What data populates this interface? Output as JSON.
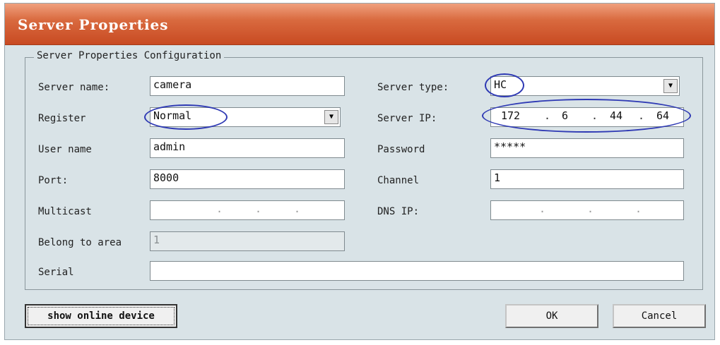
{
  "dialog": {
    "title": "Server Properties"
  },
  "group": {
    "legend": "Server Properties Configuration"
  },
  "fields": {
    "server_name": {
      "label": "Server name:",
      "value": "camera"
    },
    "register": {
      "label": "Register",
      "value": "Normal"
    },
    "user_name": {
      "label": "User name",
      "value": "admin"
    },
    "port": {
      "label": "Port:",
      "value": "8000"
    },
    "multicast": {
      "label": "Multicast",
      "value": ""
    },
    "belong_to_area": {
      "label": "Belong to area",
      "value": "1"
    },
    "serial": {
      "label": "Serial",
      "value": ""
    },
    "server_type": {
      "label": "Server type:",
      "value": "HC"
    },
    "server_ip": {
      "label": "Server IP:",
      "octets": [
        "172",
        "6",
        "44",
        "64"
      ]
    },
    "password": {
      "label": "Password",
      "value": "*****"
    },
    "channel": {
      "label": "Channel",
      "value": "1"
    },
    "dns_ip": {
      "label": "DNS IP:",
      "value": ""
    }
  },
  "buttons": {
    "show_online_device": "show online device",
    "ok": "OK",
    "cancel": "Cancel"
  },
  "annotation_color": "#2f3ab4"
}
